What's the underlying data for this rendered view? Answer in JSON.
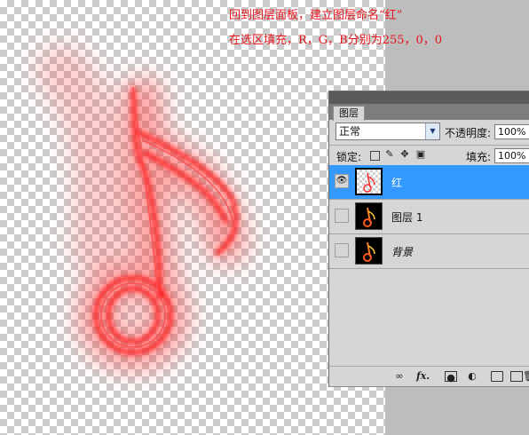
{
  "instructions": {
    "line1": "回到图层面板，建立图层命名“红”",
    "line2": "在选区填充，R，G，B分别为255，0，0"
  },
  "colors": {
    "instruction_text": "#e8141b",
    "note_red": "#ff1a1a",
    "selection_blue": "#3399ff",
    "panel_bg": "#d6d6d6"
  },
  "layers_panel": {
    "tab_label": "图层",
    "blend_mode": "正常",
    "opacity_label": "不透明度:",
    "opacity_value": "100%",
    "lock_label": "锁定:",
    "fill_label": "填充:",
    "fill_value": "100%",
    "lock_icons": [
      "lock-transparent-icon",
      "lock-paint-icon",
      "lock-move-icon",
      "lock-all-icon"
    ],
    "layers": [
      {
        "name": "红",
        "visible": true,
        "selected": true,
        "thumbnail": "transparent-red-note"
      },
      {
        "name": "图层 1",
        "visible": false,
        "selected": false,
        "thumbnail": "fire-note"
      },
      {
        "name": "背景",
        "visible": false,
        "selected": false,
        "thumbnail": "fire-note"
      }
    ],
    "footer_icons": [
      "link-layers-icon",
      "fx-icon",
      "layer-mask-icon",
      "adjustment-layer-icon",
      "new-group-icon",
      "new-layer-icon",
      "delete-layer-icon"
    ]
  }
}
